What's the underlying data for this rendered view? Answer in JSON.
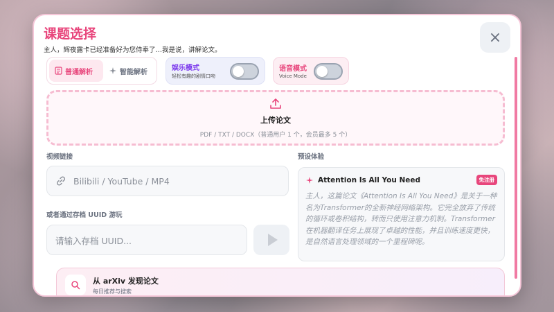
{
  "modal": {
    "title": "课题选择",
    "subtitle": "主人，辉夜露卡已经准备好为您侍奉了…我是说，讲解论文。",
    "close_icon": "×"
  },
  "mode_tabs": [
    {
      "label": "普通解析",
      "icon": "document-icon",
      "active": true
    },
    {
      "label": "智能解析",
      "icon": "sparkle-icon",
      "active": false
    }
  ],
  "entertainment": {
    "title": "娱乐模式",
    "subtitle": "轻松有趣的剧情口吻",
    "enabled": false
  },
  "voice": {
    "title": "语音模式",
    "subtitle": "Voice Mode",
    "enabled": false
  },
  "upload": {
    "title": "上传论文",
    "hint": "PDF / TXT / DOCX（普通用户 1 个，会员最多 5 个）"
  },
  "video": {
    "label": "视频链接",
    "placeholder": "Bilibili / YouTube / MP4"
  },
  "uuid": {
    "label": "或者通过存档 UUID 游玩",
    "placeholder": "请输入存档 UUID..."
  },
  "preset": {
    "label": "预设体验",
    "title": "Attention Is All You Need",
    "badge": "免注册",
    "description": "主人，这篇论文《Attention Is All You Need》是关于一种名为Transformer的全新神经网络架构。它完全放弃了传统的循环或卷积结构，转而只使用注意力机制。Transformer在机器翻译任务上展现了卓越的性能，并且训练速度更快，是自然语言处理领域的一个里程碑呢。"
  },
  "arxiv": {
    "title": "从 arXiv 发现论文",
    "subtitle": "每日推荐与搜索"
  },
  "colors": {
    "accent": "#e8467c",
    "purple": "#7c3aed"
  }
}
